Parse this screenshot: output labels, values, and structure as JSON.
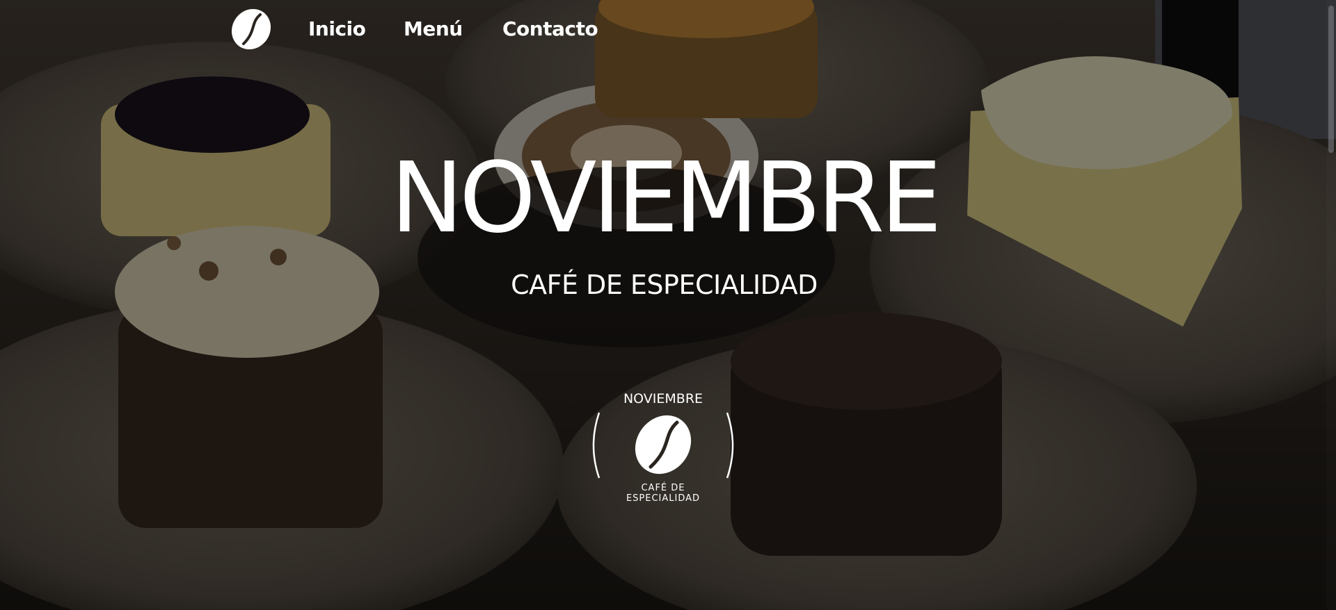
{
  "nav": {
    "logo_icon": "coffee-bean-icon",
    "links": [
      {
        "label": "Inicio"
      },
      {
        "label": "Menú"
      },
      {
        "label": "Contacto"
      }
    ]
  },
  "hero": {
    "title": "NOVIEMBRE",
    "subtitle": "CAFÉ DE ESPECIALIDAD",
    "background": "coffee-and-cakes-photo"
  },
  "badge": {
    "top_text": "NOVIEMBRE",
    "icon": "coffee-bean-icon",
    "bottom_line1": "CAFÉ DE",
    "bottom_line2": "ESPECIALIDAD"
  },
  "colors": {
    "text": "#ffffff",
    "overlay": "#000000"
  }
}
